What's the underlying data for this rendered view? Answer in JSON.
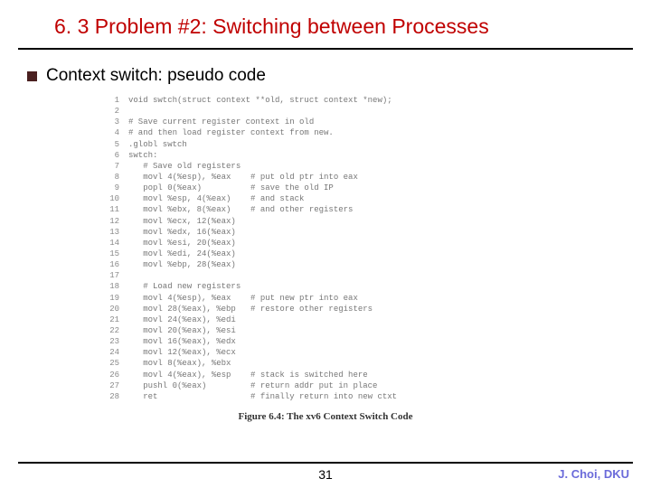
{
  "title": "6. 3 Problem #2: Switching between Processes",
  "bullet": "Context switch: pseudo code",
  "code": [
    {
      "n": "1",
      "t": "void swtch(struct context **old, struct context *new);"
    },
    {
      "n": "2",
      "t": ""
    },
    {
      "n": "3",
      "t": "# Save current register context in old"
    },
    {
      "n": "4",
      "t": "# and then load register context from new."
    },
    {
      "n": "5",
      "t": ".globl swtch"
    },
    {
      "n": "6",
      "t": "swtch:"
    },
    {
      "n": "7",
      "t": "   # Save old registers"
    },
    {
      "n": "8",
      "t": "   movl 4(%esp), %eax    # put old ptr into eax"
    },
    {
      "n": "9",
      "t": "   popl 0(%eax)          # save the old IP"
    },
    {
      "n": "10",
      "t": "   movl %esp, 4(%eax)    # and stack"
    },
    {
      "n": "11",
      "t": "   movl %ebx, 8(%eax)    # and other registers"
    },
    {
      "n": "12",
      "t": "   movl %ecx, 12(%eax)"
    },
    {
      "n": "13",
      "t": "   movl %edx, 16(%eax)"
    },
    {
      "n": "14",
      "t": "   movl %esi, 20(%eax)"
    },
    {
      "n": "15",
      "t": "   movl %edi, 24(%eax)"
    },
    {
      "n": "16",
      "t": "   movl %ebp, 28(%eax)"
    },
    {
      "n": "17",
      "t": ""
    },
    {
      "n": "18",
      "t": "   # Load new registers"
    },
    {
      "n": "19",
      "t": "   movl 4(%esp), %eax    # put new ptr into eax"
    },
    {
      "n": "20",
      "t": "   movl 28(%eax), %ebp   # restore other registers"
    },
    {
      "n": "21",
      "t": "   movl 24(%eax), %edi"
    },
    {
      "n": "22",
      "t": "   movl 20(%eax), %esi"
    },
    {
      "n": "23",
      "t": "   movl 16(%eax), %edx"
    },
    {
      "n": "24",
      "t": "   movl 12(%eax), %ecx"
    },
    {
      "n": "25",
      "t": "   movl 8(%eax), %ebx"
    },
    {
      "n": "26",
      "t": "   movl 4(%eax), %esp    # stack is switched here"
    },
    {
      "n": "27",
      "t": "   pushl 0(%eax)         # return addr put in place"
    },
    {
      "n": "28",
      "t": "   ret                   # finally return into new ctxt"
    }
  ],
  "caption_label": "Figure 6.4: ",
  "caption_text": "The xv6 Context Switch Code",
  "page_number": "31",
  "author": "J. Choi, DKU"
}
